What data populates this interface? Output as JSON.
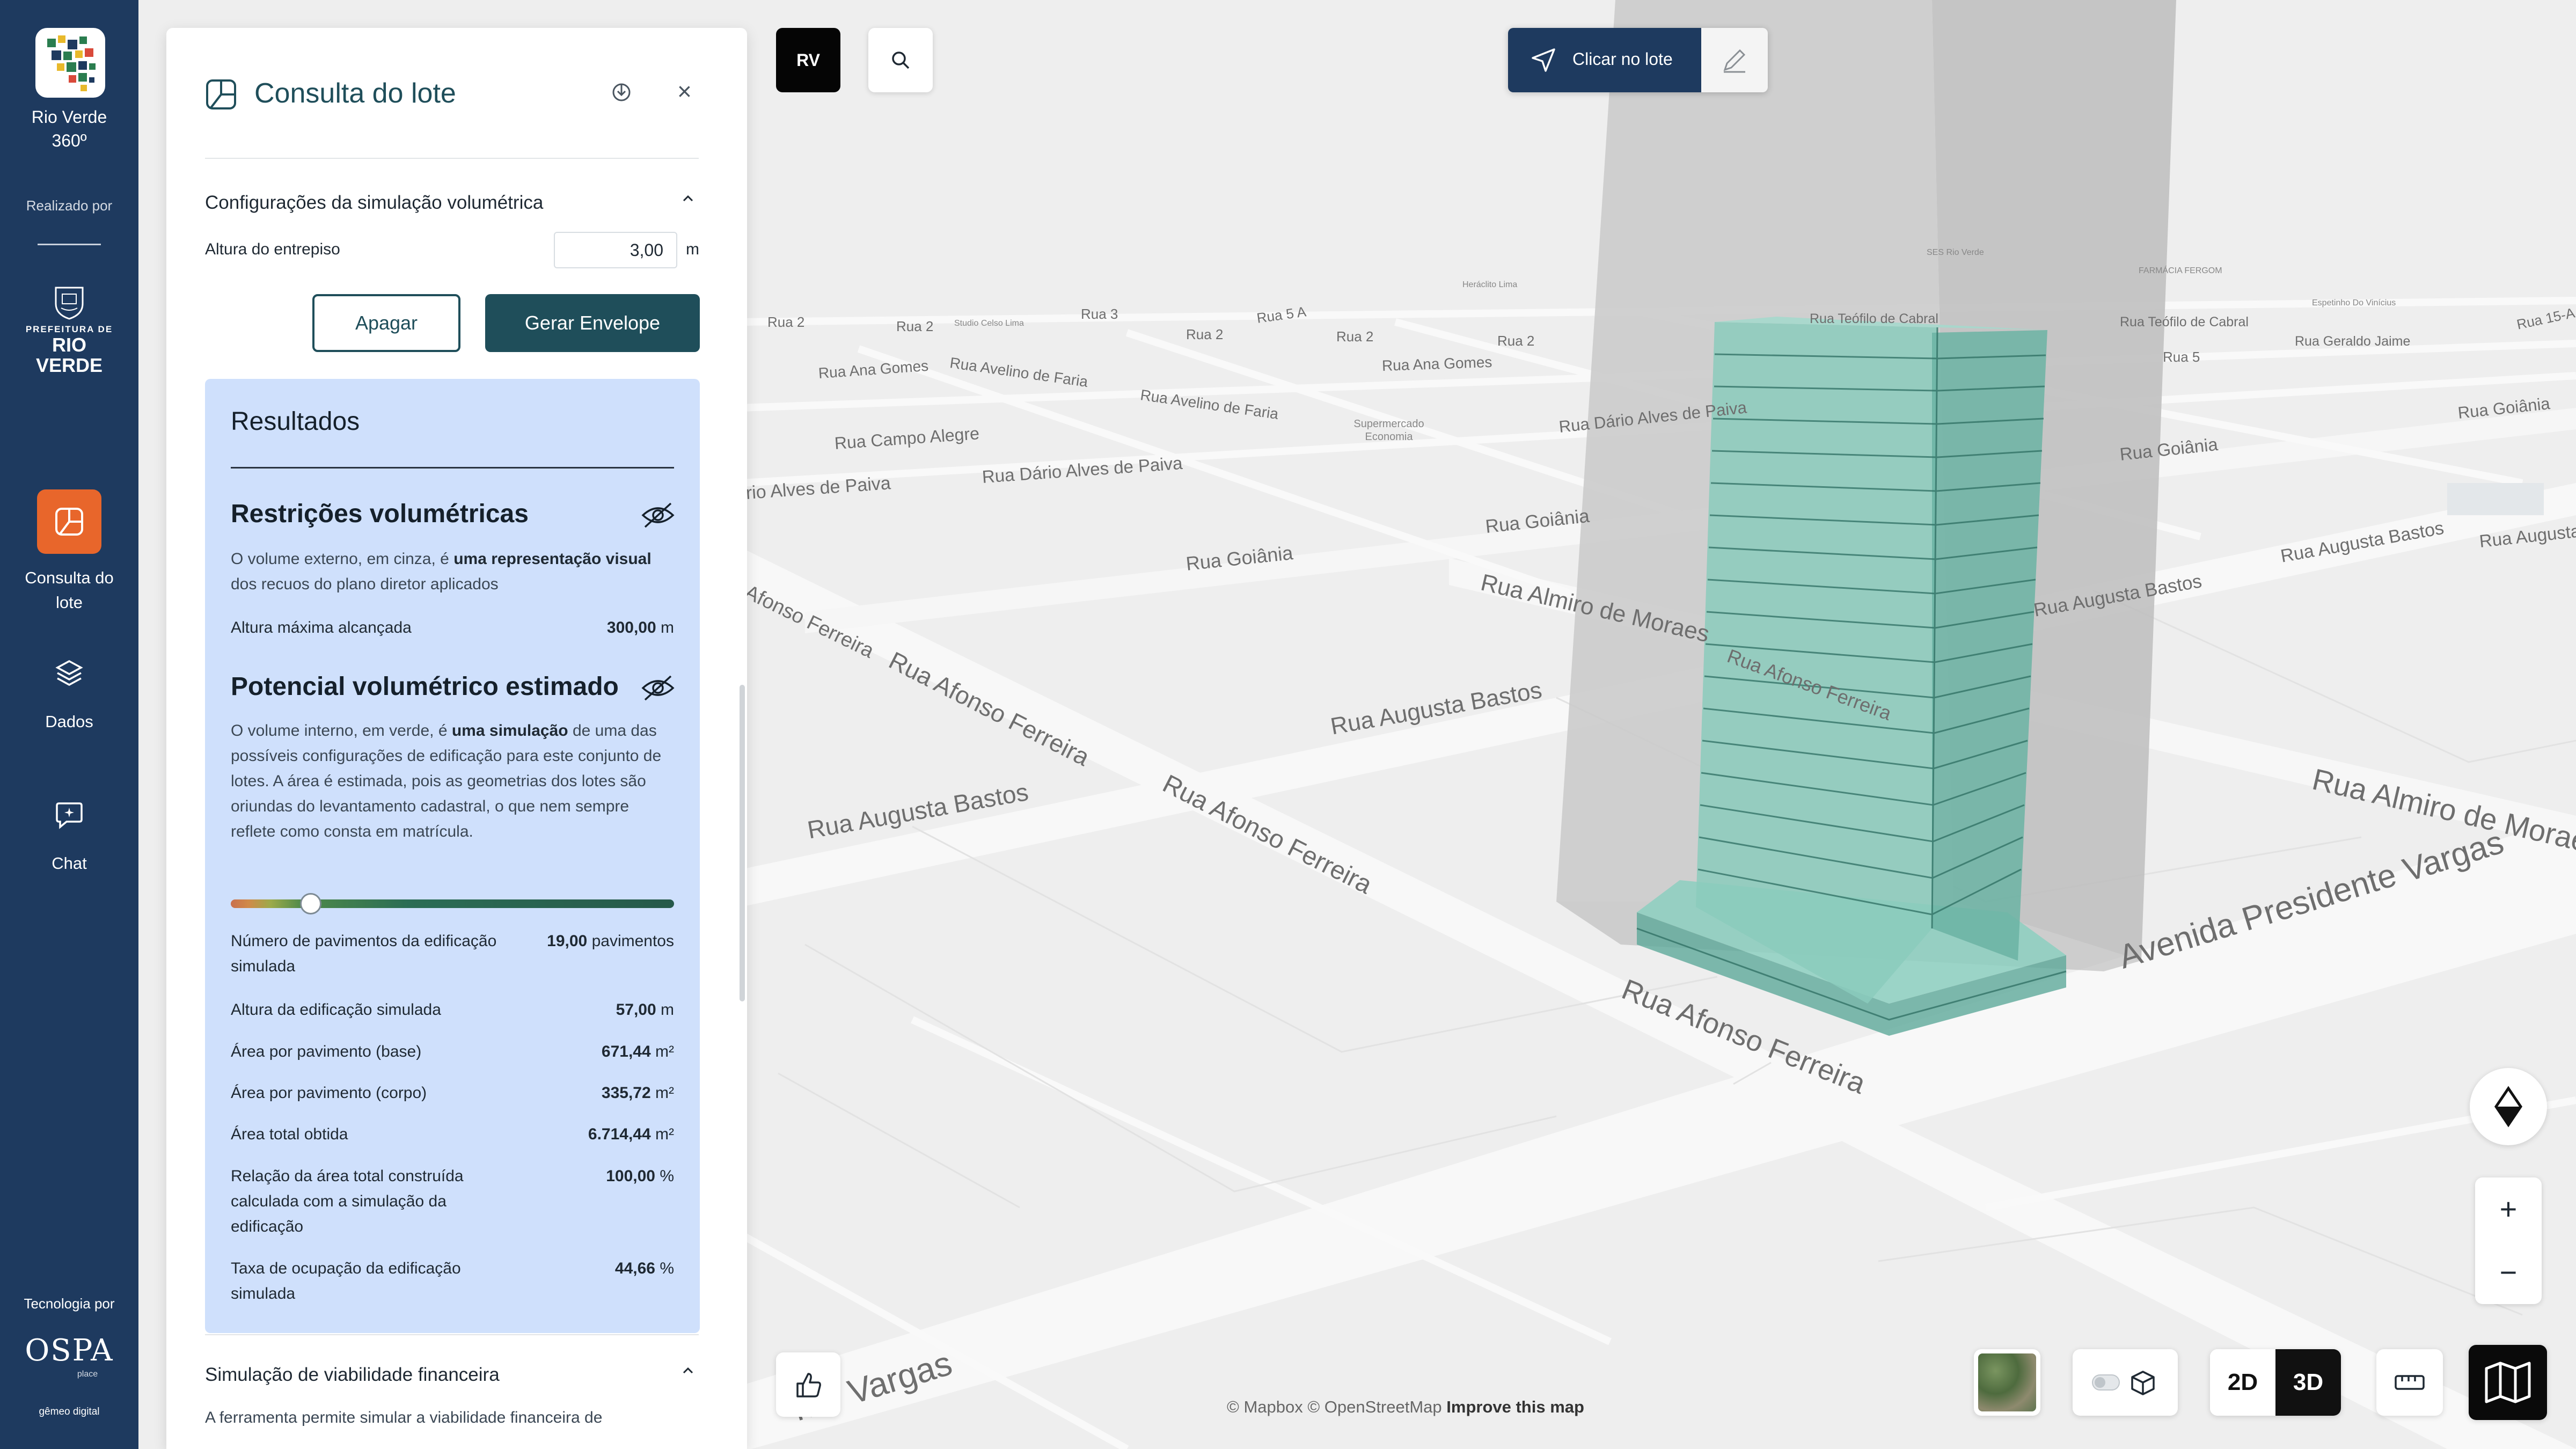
{
  "sidebar": {
    "app_name_line1": "Rio Verde",
    "app_name_line2": "360º",
    "realizado_por": "Realizado por",
    "prefeitura_line1": "PREFEITURA DE",
    "prefeitura_line2": "RIO VERDE",
    "nav": [
      {
        "label_line1": "Consulta do",
        "label_line2": "lote",
        "icon": "lot-icon",
        "active": true
      },
      {
        "label_line1": "Dados",
        "label_line2": "",
        "icon": "layers-icon",
        "active": false
      },
      {
        "label_line1": "Chat",
        "label_line2": "",
        "icon": "chat-icon",
        "active": false
      }
    ],
    "tecnologia_por": "Tecnologia por",
    "ospa": "OSPA",
    "ospa_sub": "place",
    "gemeo": "gêmeo digital"
  },
  "panel": {
    "title": "Consulta do lote",
    "section_config": "Configurações da simulação volumétrica",
    "field_label": "Altura do entrepiso",
    "field_value": "3,00",
    "field_unit": "m",
    "btn_apagar": "Apagar",
    "btn_gerar": "Gerar Envelope",
    "results_title": "Resultados",
    "restricoes_title": "Restrições volumétricas",
    "restricoes_text_a": "O volume externo, em cinza, é ",
    "restricoes_text_b": "uma representação visual",
    "restricoes_text_c": " dos recuos do plano diretor aplicados",
    "altura_max_label": "Altura máxima alcançada",
    "altura_max_value": "300,00",
    "altura_max_unit": "m",
    "potencial_title": "Potencial volumétrico estimado",
    "potencial_text_a": "O volume interno, em verde, é ",
    "potencial_text_b": "uma simulação",
    "potencial_text_c": " de uma das possíveis configurações de edificação para este conjunto de lotes. A área é estimada, pois as geometrias dos lotes são oriundas do levantamento cadastral, o que nem sempre reflete como consta em matrícula.",
    "slider_fraction": 0.18,
    "metrics": [
      {
        "label": "Número de pavimentos da edificação simulada",
        "value": "19,00",
        "unit": "pavimentos"
      },
      {
        "label": "Altura da edificação simulada",
        "value": "57,00",
        "unit": "m"
      },
      {
        "label": "Área por pavimento (base)",
        "value": "671,44",
        "unit": "m²"
      },
      {
        "label": "Área por pavimento (corpo)",
        "value": "335,72",
        "unit": "m²"
      },
      {
        "label": "Área total obtida",
        "value": "6.714,44",
        "unit": "m²"
      },
      {
        "label": "Relação da área total construída calculada com a simulação da edificação",
        "value": "100,00",
        "unit": "%"
      },
      {
        "label": "Taxa de ocupação da edificação simulada",
        "value": "44,66",
        "unit": "%"
      }
    ],
    "section_financeira": "Simulação de viabilidade financeira",
    "financeira_text": "A ferramenta permite simular a viabilidade financeira de"
  },
  "topbar": {
    "rv_label": "RV",
    "clicar_label": "Clicar no lote"
  },
  "map": {
    "streets": [
      "Rua 2",
      "Rua 2",
      "Rua 3",
      "Rua 5 A",
      "Rua 2",
      "Rua 2",
      "Rua 2",
      "Rua 5",
      "Rua 15-A",
      "Rua Ana Gomes",
      "Rua Avelino de Faria",
      "Rua Avelino de Faria",
      "Rua Ana Gomes",
      "Rua Campo Alegre",
      "Rua Dário Alves de Paiva",
      "Rua Dário Alves de Paiva",
      "Rua Goiânia",
      "Rua Goiânia",
      "Rua Goiânia",
      "Rua Goiânia",
      "Rua Almiro de Moraes",
      "Rua Almiro de Morae",
      "Rua Augusta Bastos",
      "Rua Augusta Bastos",
      "Rua Augusta Bastos",
      "Rua Augusta Bastos",
      "Rua Afonso Ferreira",
      "Rua Afonso Ferreira",
      "Rua Afonso Ferreira",
      "Rua Afonso Ferreira",
      "Avenida Presidente Vargas",
      "nte Vargas",
      "Rua Teófilo de Cabral",
      "Rua Teófilo de Cabral",
      "Rua Geraldo Jaime",
      "Rua Augusta",
      "rio Alves de Paiva",
      "Afonso Ferreira"
    ],
    "pois": [
      "Supermercado Economia",
      "Heráclito Lima",
      "Studio Celso Lima",
      "FARMÁCIA FERGOM",
      "Espetinho Do Vinícius",
      "SES Rio Verde"
    ],
    "attribution_a": "© Mapbox © OpenStreetMap",
    "attribution_b": "Improve this map"
  },
  "controls": {
    "label_2d": "2D",
    "label_3d": "3D",
    "active_mode": "3D",
    "zoom_in": "+",
    "zoom_out": "−"
  },
  "colors": {
    "sidebar": "#1e3a5f",
    "accent": "#e8662b",
    "primary": "#1f4e5a",
    "results_bg": "#cfe0fc",
    "building_green": "#7cc3b3"
  }
}
